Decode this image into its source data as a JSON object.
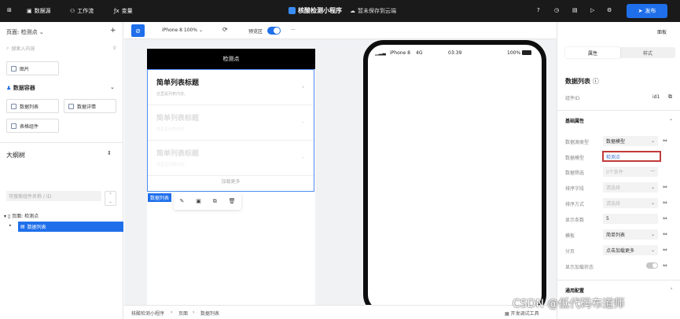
{
  "topbar": {
    "grid_icon": "grid-icon",
    "data_source_label": "数据源",
    "workflow_label": "工作流",
    "variables_label": "变量",
    "app_title": "核酸检测小程序",
    "save_status": "暂未保存到云端",
    "publish_label": "发布"
  },
  "left_panel": {
    "page_selector": "页面: 检测点",
    "add": "+",
    "search_placeholder": "搜索入内容",
    "image_component": "图片",
    "data_container_section": "数据容器",
    "data_list": "数据列表",
    "data_detail": "数据详情",
    "table_component": "表格组件",
    "outline_title": "大纲树",
    "tree_search_placeholder": "可搜索组件名称 / ID",
    "tree_page": "页面: 检测点",
    "tree_selected": "数据列表"
  },
  "canvas_toolbar": {
    "device": "iPhone 8 100%",
    "preview_label": "预览区",
    "more": "···"
  },
  "device": {
    "header": "检测点",
    "items": [
      {
        "title": "简单列表标题",
        "desc": "这里是列表内容。"
      },
      {
        "title": "简单列表标题",
        "desc": "这里是列表内容。"
      },
      {
        "title": "简单列表标题",
        "desc": "这里是列表内容。"
      }
    ],
    "load_more": "加载更多",
    "selected_tag": "数据列表"
  },
  "phone_status": {
    "carrier": "iPhone 8",
    "network": "4G",
    "time": "03:39",
    "battery": "100%"
  },
  "bottom_bar": {
    "breadcrumb_1": "核酸检测小程序",
    "breadcrumb_2": "页面",
    "breadcrumb_3": "数据列表",
    "devtools": "开发调试工具"
  },
  "right_panel": {
    "header_label": "面板",
    "tab_properties": "属性",
    "tab_style": "样式",
    "component_title": "数据列表",
    "component_id_label": "组件ID",
    "component_id_value": "id1",
    "basic_section": "基础属性",
    "rows": {
      "source_type_label": "数据源类型",
      "source_type_value": "数据模型",
      "data_model_label": "数据模型",
      "data_model_value": "检测点",
      "filter_label": "数据筛选",
      "filter_value": "0个条件",
      "sort_field_label": "排序字段",
      "sort_field_value": "请选择",
      "sort_order_label": "排序方式",
      "sort_order_value": "请选择",
      "count_label": "显示条数",
      "count_value": "5",
      "template_label": "模板",
      "template_value": "简单列表",
      "paging_label": "分页",
      "paging_value": "点击加载更多",
      "loading_label": "显示加载状态"
    },
    "general_section": "通用配置"
  },
  "watermark": "CSDN @低代码布道师"
}
